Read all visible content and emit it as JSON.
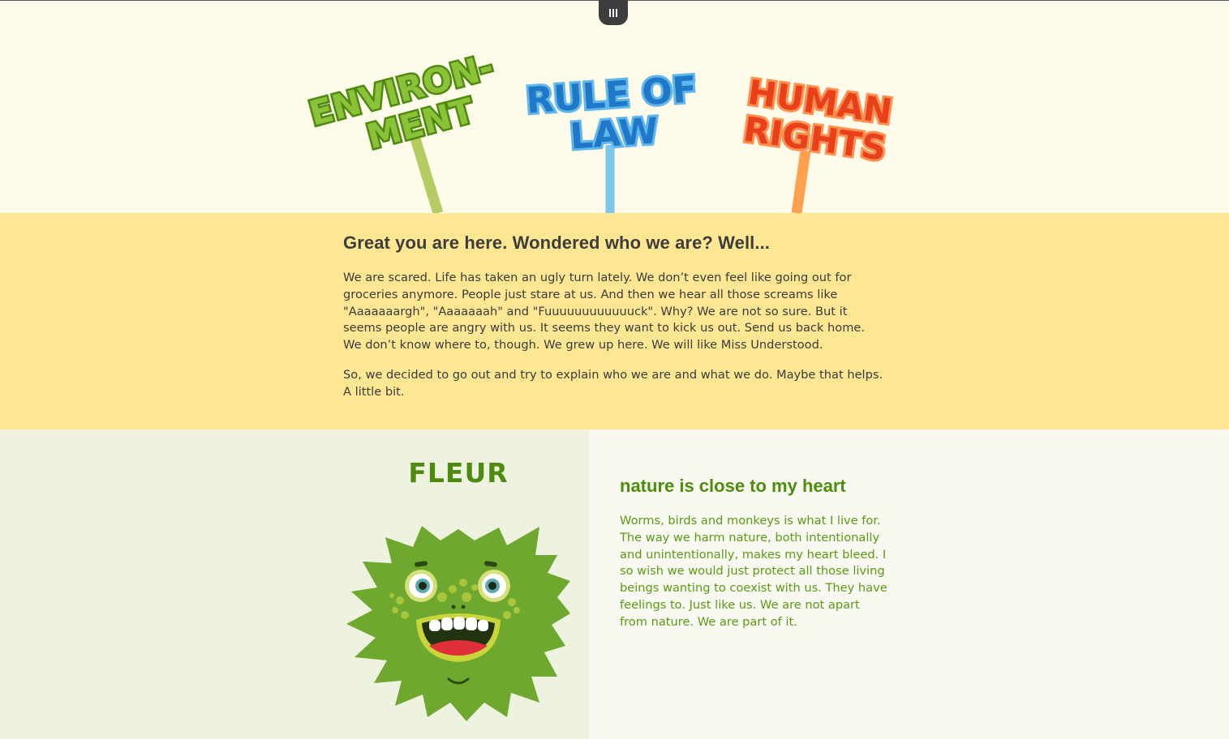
{
  "menu": {
    "icon": "menu-bars-icon"
  },
  "hero": {
    "signs": [
      {
        "lines": [
          "ENVIRON-",
          "MENT"
        ],
        "color": "#7fb52a",
        "outline": "#4f8a10",
        "pole": "#b5cc63"
      },
      {
        "lines": [
          "RULE OF",
          "LAW"
        ],
        "color": "#1f78c8",
        "outline": "#62b7ea",
        "pole": "#7fc6ee"
      },
      {
        "lines": [
          "HUMAN",
          "RIGHTS"
        ],
        "color": "#e8401a",
        "outline": "#ff8f4d",
        "pole": "#ffa04f"
      }
    ]
  },
  "intro": {
    "heading": "Great you are here. Wondered who we are? Well...",
    "paragraph1": "We are scared. Life has taken an ugly turn lately. We don’t even feel like going out for groceries anymore. People just stare at us. And then we hear all those screams like \"Aaaaaaargh\", \"Aaaaaaah\" and \"Fuuuuuuuuuuuuck\". Why? We are not so sure. But it seems people are angry with us. It seems they want to kick us out. Send us back home. We don’t know where to, though. We grew up here. We will like Miss Understood.",
    "paragraph2": "So, we decided to go out and try to explain who we are and what we do. Maybe that helps. A little bit."
  },
  "character": {
    "name": "FLEUR",
    "title": "nature is close to my heart",
    "text": "Worms, birds and monkeys is what I live for. The way we harm nature, both intentionally and unintentionally, makes my heart bleed. I so wish we would just protect all those living beings wanting to coexist with us. They have feelings to. Just like us. We are not apart from nature. We are part of it.",
    "illustration": "green-monster-illustration",
    "colors": {
      "name": "#4f8a10",
      "body": "#6fa82e",
      "text": "#5b9a15"
    }
  }
}
